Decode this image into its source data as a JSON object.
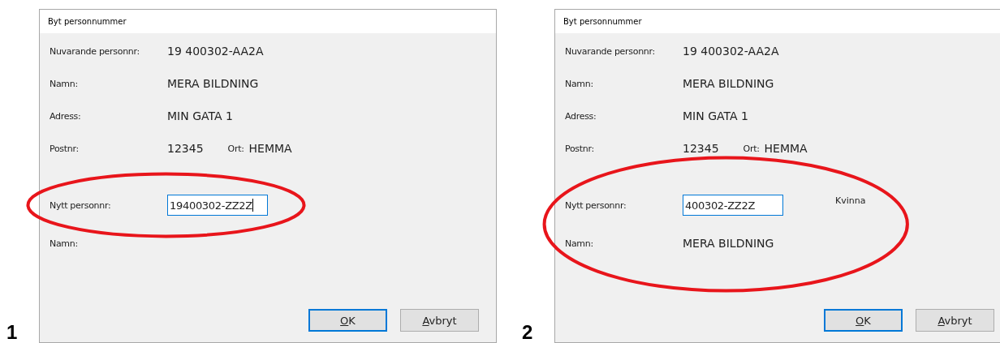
{
  "panels": [
    {
      "number": "1",
      "dialog": {
        "title": "Byt personnummer",
        "rows": [
          {
            "kind": "text",
            "label": "Nuvarande personnr:",
            "value": "19 400302-AA2A"
          },
          {
            "kind": "text",
            "label": "Namn:",
            "value": "MERA BILDNING"
          },
          {
            "kind": "text",
            "label": "Adress:",
            "value": "MIN GATA 1"
          },
          {
            "kind": "postnr",
            "label": "Postnr:",
            "value": "12345",
            "ort_label": "Ort:",
            "ort_value": "HEMMA"
          }
        ],
        "new_rows": [
          {
            "kind": "input",
            "label": "Nytt personnr:",
            "value": "19400302-ZZ2Z",
            "focused": true,
            "circled": true
          },
          {
            "kind": "text",
            "label": "Namn:",
            "circled": false
          }
        ],
        "buttons": [
          {
            "label": "OK",
            "default": true
          },
          {
            "label": "Avbryt",
            "default": false
          }
        ]
      }
    },
    {
      "number": "2",
      "dialog": {
        "title": "Byt personnummer",
        "rows": [
          {
            "kind": "text",
            "label": "Nuvarande personnr:",
            "value": "19 400302-AA2A"
          },
          {
            "kind": "text",
            "label": "Namn:",
            "value": "MERA BILDNING"
          },
          {
            "kind": "text",
            "label": "Adress:",
            "value": "MIN GATA 1"
          },
          {
            "kind": "postnr",
            "label": "Postnr:",
            "value": "12345",
            "ort_label": "Ort:",
            "ort_value": "HEMMA"
          }
        ],
        "new_rows": [
          {
            "kind": "input",
            "label": "Nytt personnr:",
            "value": "400302-ZZ2Z",
            "focused": false,
            "note": "Kvinna",
            "circled": true
          },
          {
            "kind": "text",
            "label": "Namn:",
            "value": "MERA BILDNING",
            "circled": true
          }
        ],
        "buttons": [
          {
            "label": "OK",
            "default": true
          },
          {
            "label": "Avbryt",
            "default": false
          }
        ]
      }
    }
  ]
}
